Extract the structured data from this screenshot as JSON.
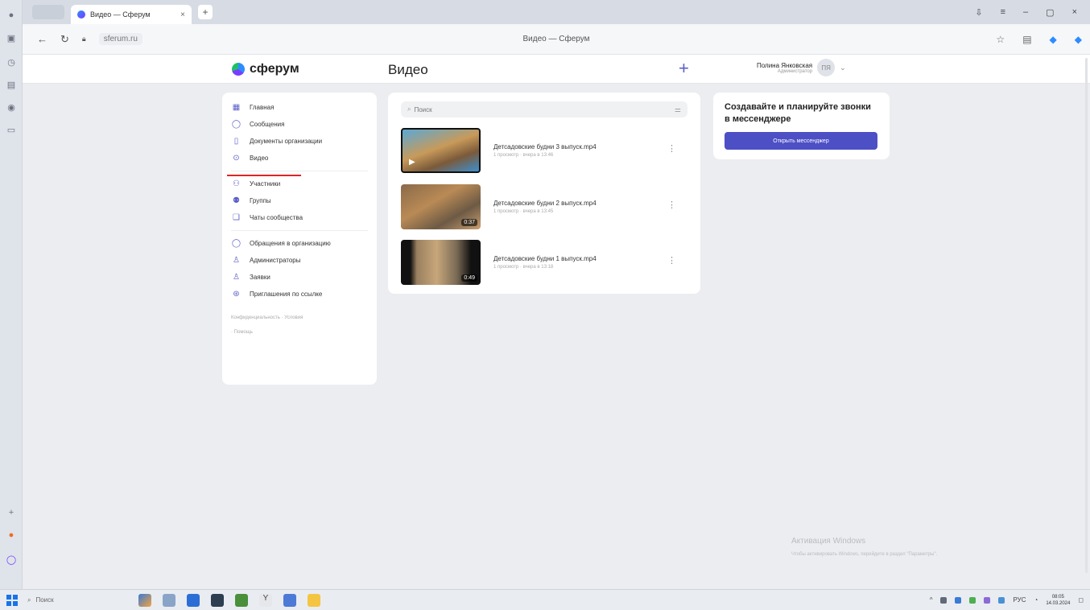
{
  "browser": {
    "tab_title": "Видео — Сферум",
    "window_title": "Видео — Сферум",
    "url": "sferum.ru",
    "colors": {
      "accent": "#5b5fc7",
      "button": "#4d4fc5",
      "active_marker": "#e02424"
    }
  },
  "app": {
    "logo": "сферум",
    "page_title": "Видео",
    "plus": "+",
    "profile": {
      "name": "Полина Янковская",
      "role": "Администратор",
      "avatar": "ПЯ"
    }
  },
  "nav": {
    "group1": [
      {
        "label": "Главная",
        "icon": "grid-icon"
      },
      {
        "label": "Сообщения",
        "icon": "chat-icon"
      },
      {
        "label": "Документы организации",
        "icon": "document-icon"
      },
      {
        "label": "Видео",
        "icon": "play-icon",
        "active": true
      }
    ],
    "group2": [
      {
        "label": "Участники",
        "icon": "people-icon"
      },
      {
        "label": "Группы",
        "icon": "group-icon"
      },
      {
        "label": "Чаты сообщества",
        "icon": "chats-icon"
      }
    ],
    "group3": [
      {
        "label": "Обращения в организацию",
        "icon": "appeal-icon"
      },
      {
        "label": "Администраторы",
        "icon": "admin-icon"
      },
      {
        "label": "Заявки",
        "icon": "request-icon"
      },
      {
        "label": "Приглашения по ссылке",
        "icon": "link-invite-icon"
      }
    ],
    "footer": {
      "privacy": "Конфиденциальность",
      "terms": "Условия",
      "help": "Помощь"
    }
  },
  "videos": {
    "search_placeholder": "Поиск",
    "items": [
      {
        "title": "Детсадовские будни 3 выпуск.mp4",
        "meta": "1 просмотр · вчера в 13:46",
        "duration": ""
      },
      {
        "title": "Детсадовские будни 2 выпуск.mp4",
        "meta": "1 просмотр · вчера в 13:45",
        "duration": "0:37"
      },
      {
        "title": "Детсадовские будни 1 выпуск.mp4",
        "meta": "1 просмотр · вчера в 13:18",
        "duration": "0:49"
      }
    ]
  },
  "promo": {
    "title": "Создавайте и планируйте звонки в мессенджере",
    "button": "Открыть мессенджер"
  },
  "watermark": {
    "line1": "Активация Windows",
    "line2": "Чтобы активировать Windows, перейдите в раздел \"Параметры\"."
  },
  "taskbar": {
    "search": "Поиск",
    "lang": "РУС",
    "time": "08:05",
    "date": "14.03.2024"
  }
}
